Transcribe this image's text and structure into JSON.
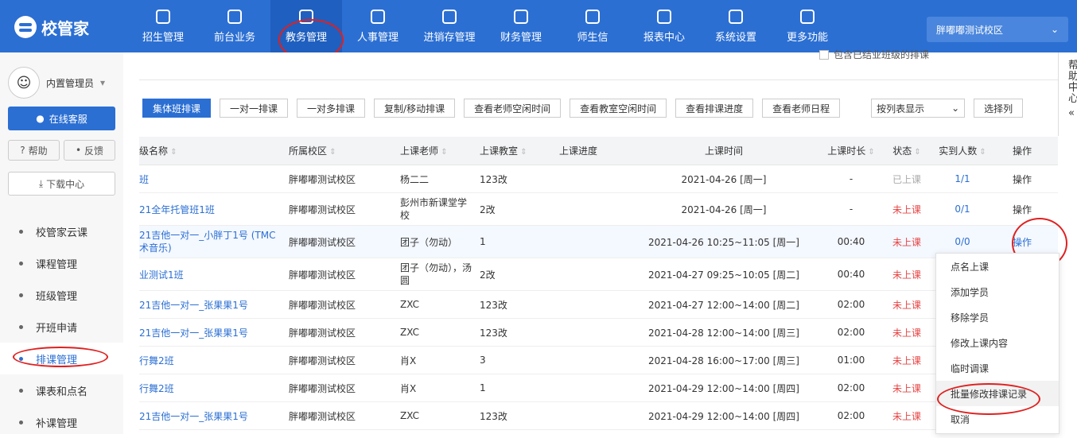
{
  "app": {
    "name": "校管家",
    "campus": "胖嘟嘟测试校区"
  },
  "nav": [
    {
      "label": "招生管理",
      "icon": "person-add-icon"
    },
    {
      "label": "前台业务",
      "icon": "monitor-icon"
    },
    {
      "label": "教务管理",
      "icon": "book-icon"
    },
    {
      "label": "人事管理",
      "icon": "person-icon"
    },
    {
      "label": "进销存管理",
      "icon": "inventory-icon"
    },
    {
      "label": "财务管理",
      "icon": "yen-icon"
    },
    {
      "label": "师生信",
      "icon": "message-icon"
    },
    {
      "label": "报表中心",
      "icon": "chart-icon"
    },
    {
      "label": "系统设置",
      "icon": "gear-icon"
    },
    {
      "label": "更多功能",
      "icon": "more-icon"
    }
  ],
  "sidebar": {
    "user": "内置管理员",
    "service": "在线客服",
    "help": "帮助",
    "feedback": "反馈",
    "download": "下载中心",
    "items": [
      "校管家云课",
      "课程管理",
      "班级管理",
      "开班申请",
      "排课管理",
      "课表和点名",
      "补课管理"
    ]
  },
  "main": {
    "checkbox_label": "包含已结业班级的排课",
    "toolbar": [
      "集体班排课",
      "一对一排课",
      "一对多排课",
      "复制/移动排课",
      "查看老师空闲时间",
      "查看教室空闲时间",
      "查看排课进度",
      "查看老师日程"
    ],
    "view_select": "按列表显示",
    "select_columns": "选择列",
    "columns": [
      "级名称",
      "所属校区",
      "上课老师",
      "上课教室",
      "上课进度",
      "上课时间",
      "上课时长",
      "状态",
      "实到人数",
      "操作"
    ],
    "rows": [
      {
        "name": "班",
        "campus": "胖嘟嘟测试校区",
        "teacher": "杨二二",
        "room": "123改",
        "progress": "",
        "time": "2021-04-26 [周一]",
        "duration": "-",
        "status": "已上课",
        "attend": "1/1",
        "op": "操作"
      },
      {
        "name": "21全年托管班1班",
        "campus": "胖嘟嘟测试校区",
        "teacher": "彭州市新课堂学校",
        "room": "2改",
        "progress": "",
        "time": "2021-04-26 [周一]",
        "duration": "-",
        "status": "未上课",
        "attend": "0/1",
        "op": "操作"
      },
      {
        "name": "21吉他一对一_小胖丁1号 (TMC术音乐)",
        "campus": "胖嘟嘟测试校区",
        "teacher": "团子（勿动）",
        "room": "1",
        "progress": "",
        "time": "2021-04-26 10:25~11:05 [周一]",
        "duration": "00:40",
        "status": "未上课",
        "attend": "0/0",
        "op": "操作"
      },
      {
        "name": "业测试1班",
        "campus": "胖嘟嘟测试校区",
        "teacher": "团子（勿动），汤圆",
        "room": "2改",
        "progress": "",
        "time": "2021-04-27 09:25~10:05 [周二]",
        "duration": "00:40",
        "status": "未上课",
        "attend": "",
        "op": ""
      },
      {
        "name": "21吉他一对一_张果果1号",
        "campus": "胖嘟嘟测试校区",
        "teacher": "ZXC",
        "room": "123改",
        "progress": "",
        "time": "2021-04-27 12:00~14:00 [周二]",
        "duration": "02:00",
        "status": "未上课",
        "attend": "",
        "op": ""
      },
      {
        "name": "21吉他一对一_张果果1号",
        "campus": "胖嘟嘟测试校区",
        "teacher": "ZXC",
        "room": "123改",
        "progress": "",
        "time": "2021-04-28 12:00~14:00 [周三]",
        "duration": "02:00",
        "status": "未上课",
        "attend": "",
        "op": ""
      },
      {
        "name": "行舞2班",
        "campus": "胖嘟嘟测试校区",
        "teacher": "肖X",
        "room": "3",
        "progress": "",
        "time": "2021-04-28 16:00~17:00 [周三]",
        "duration": "01:00",
        "status": "未上课",
        "attend": "",
        "op": ""
      },
      {
        "name": "行舞2班",
        "campus": "胖嘟嘟测试校区",
        "teacher": "肖X",
        "room": "1",
        "progress": "",
        "time": "2021-04-29 12:00~14:00 [周四]",
        "duration": "02:00",
        "status": "未上课",
        "attend": "",
        "op": ""
      },
      {
        "name": "21吉他一对一_张果果1号",
        "campus": "胖嘟嘟测试校区",
        "teacher": "ZXC",
        "room": "123改",
        "progress": "",
        "time": "2021-04-29 12:00~14:00 [周四]",
        "duration": "02:00",
        "status": "未上课",
        "attend": "",
        "op": ""
      }
    ]
  },
  "help_panel": {
    "text": "帮助中心"
  },
  "dropdown": [
    "点名上课",
    "添加学员",
    "移除学员",
    "修改上课内容",
    "临时调课",
    "批量修改排课记录",
    "取消"
  ]
}
